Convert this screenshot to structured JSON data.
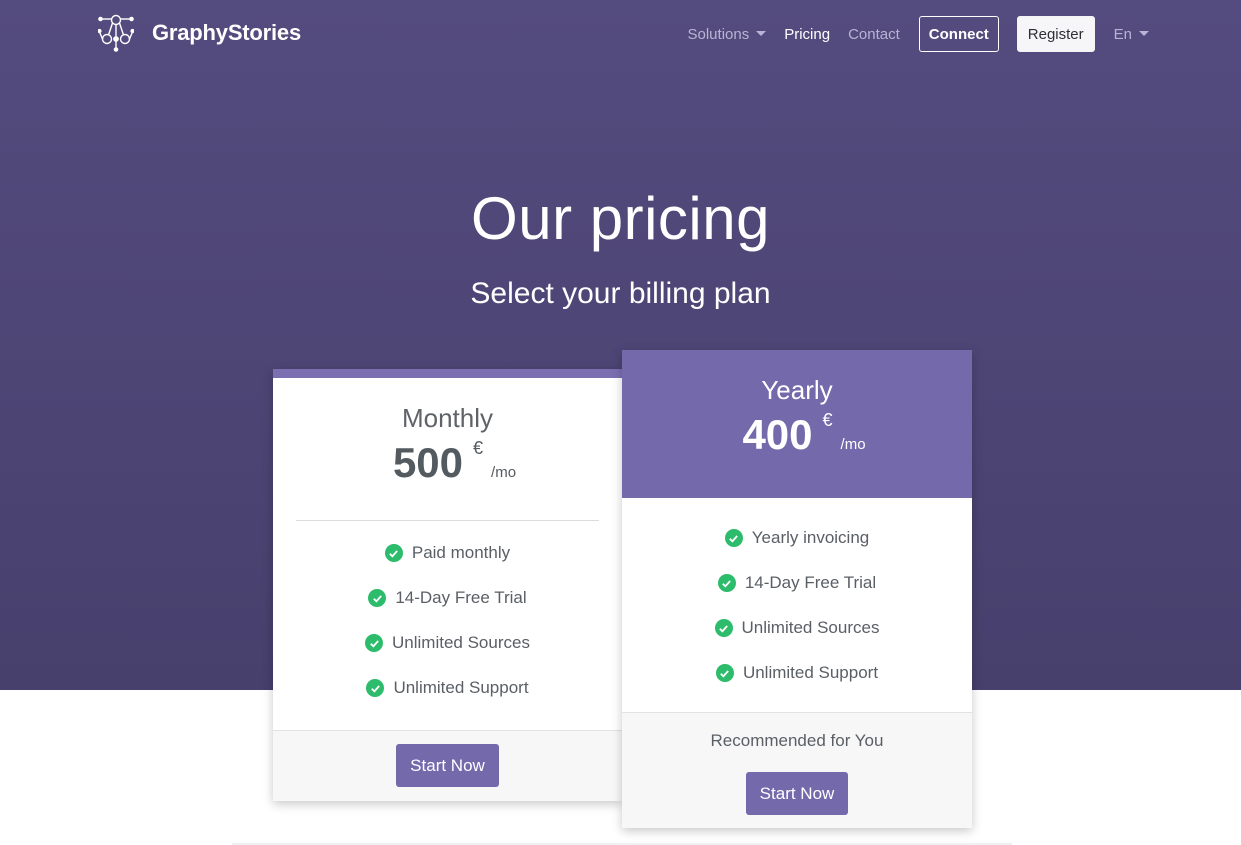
{
  "brand": {
    "name": "GraphyStories",
    "logo_icon": "graph-network-icon"
  },
  "nav": {
    "solutions": "Solutions",
    "pricing": "Pricing",
    "contact": "Contact",
    "connect": "Connect",
    "register": "Register",
    "language": "En"
  },
  "hero": {
    "title": "Our pricing",
    "subtitle": "Select your billing plan"
  },
  "plans": [
    {
      "name": "Monthly",
      "price": "500",
      "currency": "€",
      "unit": "/mo",
      "features": [
        "Paid monthly",
        "14-Day Free Trial",
        "Unlimited Sources",
        "Unlimited Support"
      ],
      "cta": "Start Now"
    },
    {
      "name": "Yearly",
      "price": "400",
      "currency": "€",
      "unit": "/mo",
      "features": [
        "Yearly invoicing",
        "14-Day Free Trial",
        "Unlimited Sources",
        "Unlimited Support"
      ],
      "note": "Recommended for You",
      "cta": "Start Now"
    }
  ],
  "colors": {
    "hero_bg": "#4e4676",
    "accent": "#7469ab",
    "check": "#2dbc6b",
    "nav_muted": "#b9b4d3"
  }
}
